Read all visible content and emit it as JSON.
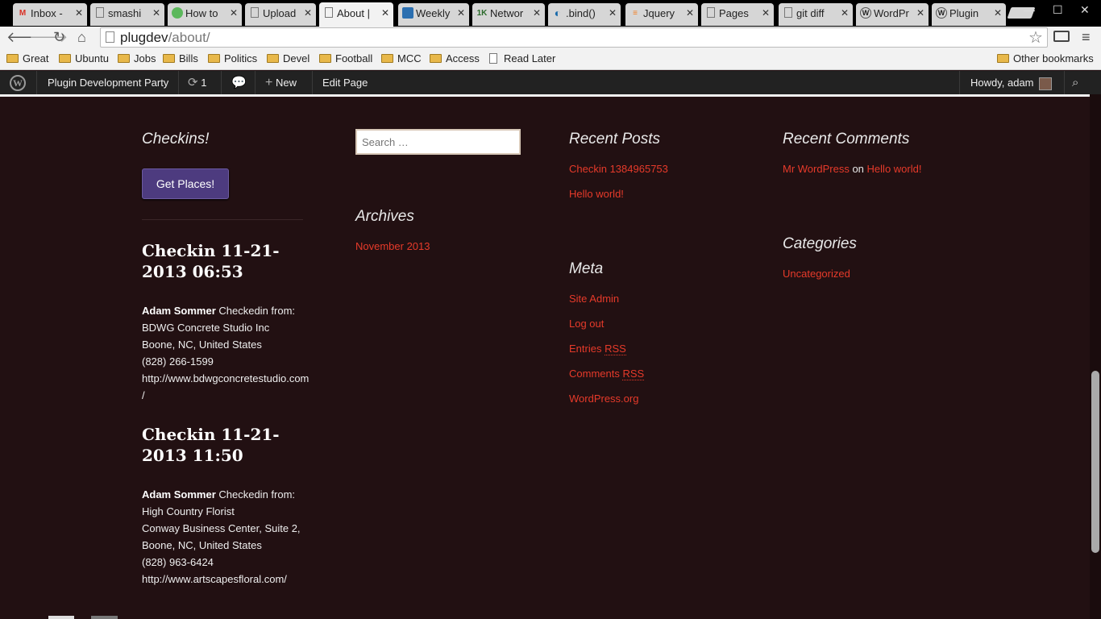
{
  "browser": {
    "tabs": [
      {
        "title": "Inbox -",
        "icon": "gmail-icon"
      },
      {
        "title": "smashi",
        "icon": "page-icon"
      },
      {
        "title": "How to",
        "icon": "green-icon"
      },
      {
        "title": "Upload",
        "icon": "page-icon"
      },
      {
        "title": "About |",
        "icon": "page-icon",
        "active": true
      },
      {
        "title": "Weekly",
        "icon": "trello-icon"
      },
      {
        "title": "Networ",
        "icon": "1k-icon"
      },
      {
        "title": ".bind()",
        "icon": "jquery-icon"
      },
      {
        "title": "Jquery",
        "icon": "stackoverflow-icon"
      },
      {
        "title": "Pages",
        "icon": "page-icon"
      },
      {
        "title": "git diff",
        "icon": "page-icon"
      },
      {
        "title": "WordPr",
        "icon": "wordpress-icon"
      },
      {
        "title": "Plugin",
        "icon": "wordpress-icon"
      }
    ],
    "url_host": "plugdev",
    "url_path": "/about/",
    "bookmarks": [
      "Great",
      "Ubuntu",
      "Jobs",
      "Bills",
      "Politics",
      "Devel",
      "Football",
      "MCC",
      "Access"
    ],
    "read_later": "Read Later",
    "other_bookmarks": "Other bookmarks"
  },
  "adminbar": {
    "site_name": "Plugin Development Party",
    "updates_count": "1",
    "new_label": "New",
    "edit_label": "Edit Page",
    "howdy": "Howdy, adam"
  },
  "footer": {
    "col1": {
      "title": "Checkins!",
      "button": "Get Places!",
      "checkins": [
        {
          "title": "Checkin 11-21-2013 06:53",
          "user": "Adam Sommer",
          "text": "Checkedin from:",
          "place": "BDWG Concrete Studio Inc",
          "address": "Boone, NC, United States",
          "phone": "(828) 266-1599",
          "url": "http://www.bdwgconcretestudio.com/"
        },
        {
          "title": "Checkin 11-21-2013 11:50",
          "user": "Adam Sommer",
          "text": "Checkedin from:",
          "place": "High Country Florist",
          "address": "Conway Business Center, Suite 2, Boone, NC, United States",
          "phone": "(828) 963-6424",
          "url": "http://www.artscapesfloral.com/"
        }
      ]
    },
    "col2": {
      "search_placeholder": "Search …",
      "archives_title": "Archives",
      "archives": [
        "November 2013"
      ]
    },
    "col3": {
      "recent_posts_title": "Recent Posts",
      "recent_posts": [
        "Checkin 1384965753",
        "Hello world!"
      ],
      "meta_title": "Meta",
      "meta_links": [
        "Site Admin",
        "Log out"
      ],
      "entries_rss": "Entries",
      "comments_rss": "Comments",
      "rss": "RSS",
      "wordpress_org": "WordPress.org"
    },
    "col4": {
      "recent_comments_title": "Recent Comments",
      "comment_author": "Mr WordPress",
      "comment_on": "on",
      "comment_post": "Hello world!",
      "categories_title": "Categories",
      "categories": [
        "Uncategorized"
      ]
    }
  },
  "colors": {
    "background": "#221012",
    "link": "#e63a2a",
    "button": "#4d3b7f"
  }
}
